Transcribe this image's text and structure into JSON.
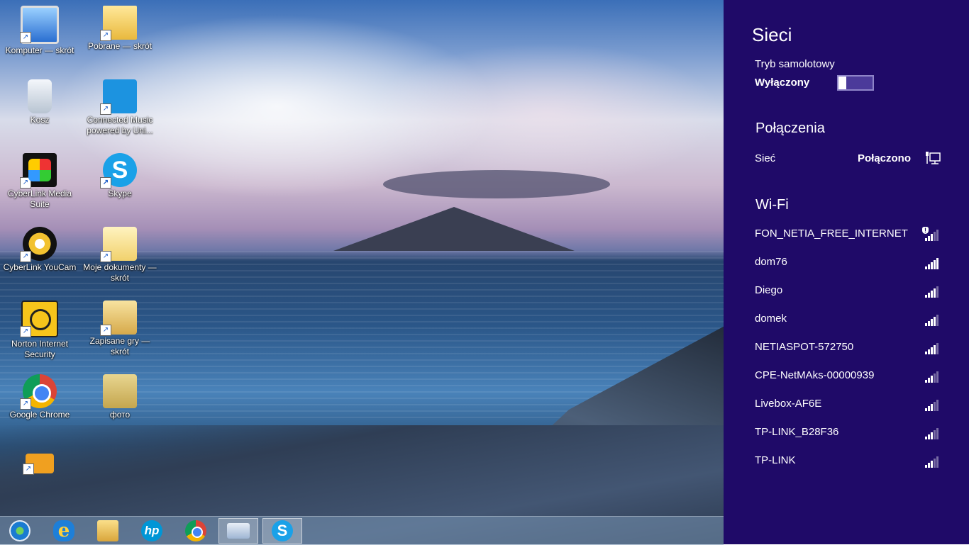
{
  "desktop": {
    "icons": [
      {
        "label": "Komputer — skrót",
        "icon": "computer-icon"
      },
      {
        "label": "Pobrane — skrót",
        "icon": "downloads-folder-icon"
      },
      {
        "label": "Kosz",
        "icon": "recycle-bin-icon"
      },
      {
        "label": "Connected Music powered by Uni...",
        "icon": "connected-music-icon"
      },
      {
        "label": "CyberLink Media Suite",
        "icon": "cyberlink-media-suite-icon"
      },
      {
        "label": "Skype",
        "icon": "skype-icon"
      },
      {
        "label": "CyberLink YouCam",
        "icon": "cyberlink-youcam-icon"
      },
      {
        "label": "Moje dokumenty — skrót",
        "icon": "documents-folder-icon"
      },
      {
        "label": "Norton Internet Security",
        "icon": "norton-icon"
      },
      {
        "label": "Zapisane gry — skrót",
        "icon": "saved-games-folder-icon"
      },
      {
        "label": "Google Chrome",
        "icon": "chrome-icon"
      },
      {
        "label": "фото",
        "icon": "photo-folder-icon"
      },
      {
        "label": "",
        "icon": "pb-app-icon"
      }
    ]
  },
  "taskbar": {
    "items": [
      "start-orb-icon",
      "internet-explorer-icon",
      "file-explorer-icon",
      "hp-icon",
      "chrome-icon",
      "on-screen-keyboard-icon",
      "skype-icon"
    ]
  },
  "panel": {
    "title": "Sieci",
    "airplane": {
      "label": "Tryb samolotowy",
      "state": "Wyłączony"
    },
    "connections": {
      "heading": "Połączenia",
      "network_label": "Sieć",
      "network_status": "Połączono"
    },
    "wifi": {
      "heading": "Wi-Fi",
      "networks": [
        {
          "name": "FON_NETIA_FREE_INTERNET",
          "signal": "weak",
          "secured": false
        },
        {
          "name": "dom76",
          "signal": "full"
        },
        {
          "name": "Diego",
          "signal": "mid"
        },
        {
          "name": "domek",
          "signal": "mid"
        },
        {
          "name": "NETIASPOT-572750",
          "signal": "mid"
        },
        {
          "name": "CPE-NetMAks-00000939",
          "signal": "weak"
        },
        {
          "name": "Livebox-AF6E",
          "signal": "weak"
        },
        {
          "name": "TP-LINK_B28F36",
          "signal": "weak"
        },
        {
          "name": "TP-LINK",
          "signal": "weak"
        }
      ]
    }
  }
}
